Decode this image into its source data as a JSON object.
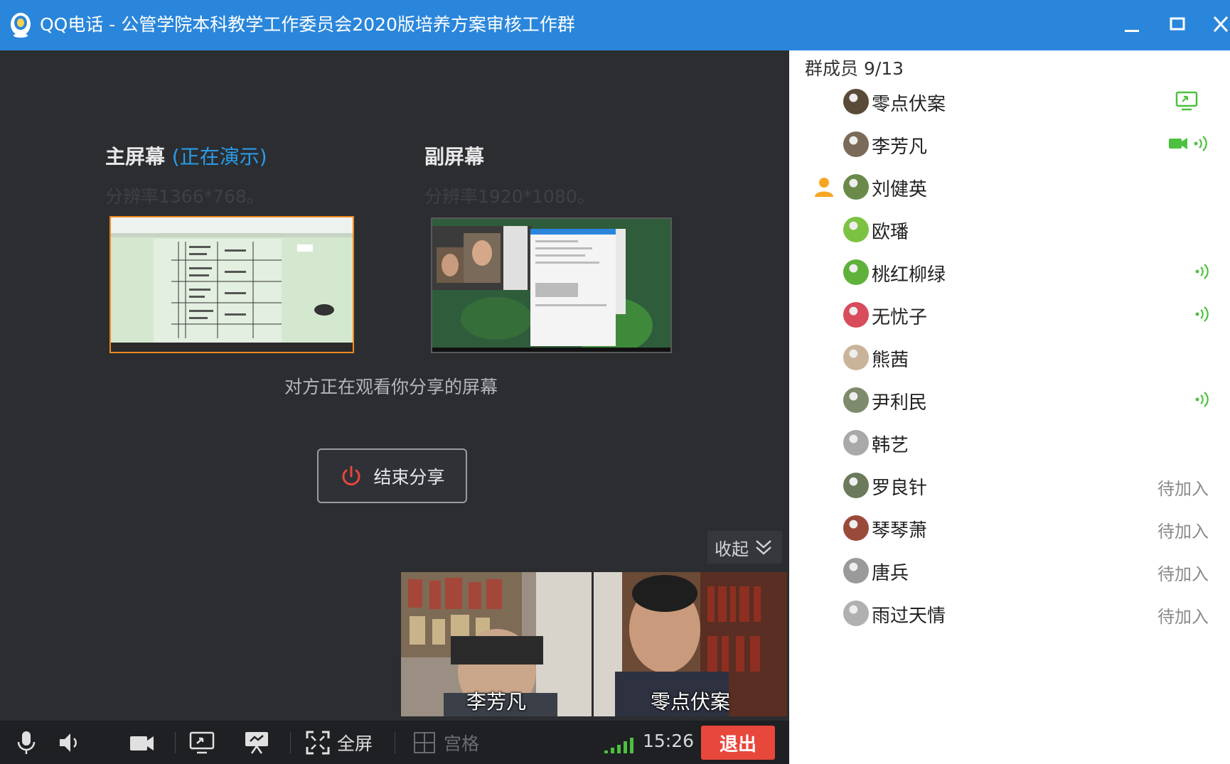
{
  "window": {
    "title": "QQ电话 - 公管学院本科教学工作委员会2020版培养方案审核工作群"
  },
  "main": {
    "primary_screen_title": "主屏幕",
    "primary_presenting": "(正在演示)",
    "primary_resolution": "分辨率1366*768。",
    "secondary_screen_title": "副屏幕",
    "secondary_resolution": "分辨率1920*1080。",
    "watching_text": "对方正在观看你分享的屏幕",
    "end_share_label": "结束分享",
    "collapse_label": "收起"
  },
  "videos": [
    {
      "name": "李芳凡"
    },
    {
      "name": "零点伏案"
    }
  ],
  "toolbar": {
    "fullscreen_label": "全屏",
    "grid_label": "宫格",
    "time": "15:26",
    "exit_label": "退出"
  },
  "members_panel": {
    "header": "群成员 9/13",
    "members": [
      {
        "name": "零点伏案",
        "status": "",
        "icon": "screen-share-icon",
        "avatar_color": "#5a4a38"
      },
      {
        "name": "李芳凡",
        "status": "",
        "icon": "camera-speaking-icon",
        "avatar_color": "#7a6a58"
      },
      {
        "name": "刘健英",
        "status": "",
        "icon": "",
        "avatar_color": "#6b8a4a",
        "host": true
      },
      {
        "name": "欧璠",
        "status": "",
        "icon": "",
        "avatar_color": "#7cc242"
      },
      {
        "name": "桃红柳绿",
        "status": "",
        "icon": "speaking-icon",
        "avatar_color": "#5fb13a"
      },
      {
        "name": "无忧子",
        "status": "",
        "icon": "speaking-icon",
        "avatar_color": "#d84c5c"
      },
      {
        "name": "熊茜",
        "status": "",
        "icon": "",
        "avatar_color": "#c9b49a"
      },
      {
        "name": "尹利民",
        "status": "",
        "icon": "speaking-icon",
        "avatar_color": "#7d8a6c"
      },
      {
        "name": "韩艺",
        "status": "",
        "icon": "",
        "avatar_color": "#a9a9a9"
      },
      {
        "name": "罗良针",
        "status": "待加入",
        "icon": "",
        "avatar_color": "#6a7a5a"
      },
      {
        "name": "琴琴萧",
        "status": "待加入",
        "icon": "",
        "avatar_color": "#9a4a3a"
      },
      {
        "name": "唐兵",
        "status": "待加入",
        "icon": "",
        "avatar_color": "#9a9a9a"
      },
      {
        "name": "雨过天情",
        "status": "待加入",
        "icon": "",
        "avatar_color": "#b0b0b0"
      }
    ]
  },
  "colors": {
    "titlebar": "#2a86db",
    "accent": "#2a9be6",
    "exit": "#e8473b",
    "speaking_green": "#4cc13e"
  }
}
